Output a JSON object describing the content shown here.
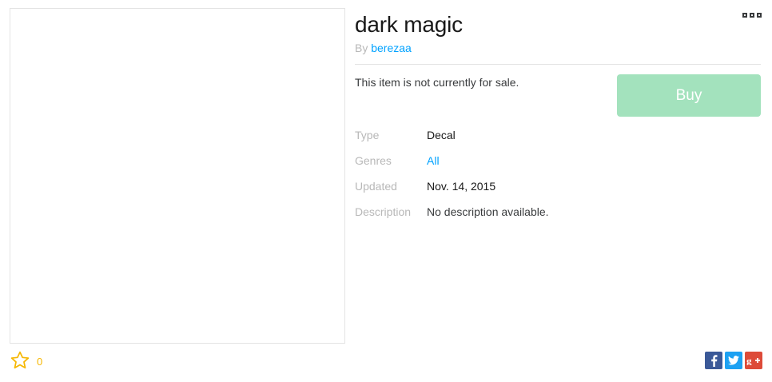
{
  "item": {
    "title": "dark magic",
    "by_prefix": "By",
    "creator": "berezaa",
    "sale_note": "This item is not currently for sale.",
    "buy_label": "Buy",
    "favorites_count": "0"
  },
  "info": {
    "type_label": "Type",
    "type_value": "Decal",
    "genres_label": "Genres",
    "genres_value": "All",
    "updated_label": "Updated",
    "updated_value": "Nov. 14, 2015",
    "description_label": "Description",
    "description_value": "No description available."
  },
  "icons": {
    "favorite": "star-outline-icon",
    "more": "more-dots-icon",
    "share": [
      "facebook-icon",
      "twitter-icon",
      "google-plus-icon"
    ]
  },
  "colors": {
    "buy_disabled": "#a3e2bd",
    "link": "#00a2ff",
    "favorite": "#f6b702",
    "label_gray": "#b8b8b8"
  }
}
